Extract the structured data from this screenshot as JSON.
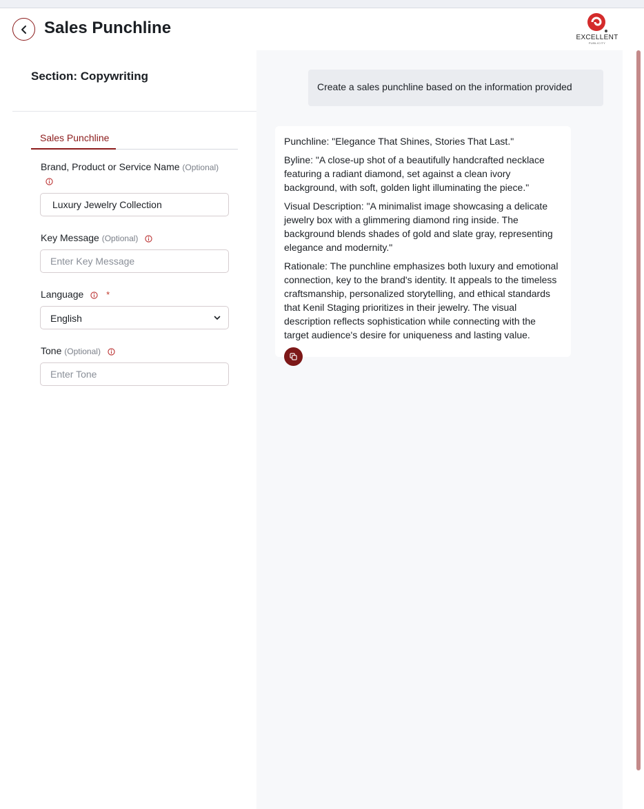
{
  "header": {
    "title": "Sales Punchline",
    "logo_text": "EXCELLENT",
    "logo_subtext": "PUBLICITY"
  },
  "left": {
    "section_title": "Section: Copywriting",
    "tab_active": "Sales Punchline",
    "fields": {
      "brand": {
        "label": "Brand, Product or Service Name",
        "optional": "(Optional)",
        "value": "Luxury Jewelry Collection"
      },
      "key_message": {
        "label": "Key Message",
        "optional": "(Optional)",
        "placeholder": "Enter Key Message"
      },
      "language": {
        "label": "Language",
        "required_mark": "*",
        "value": "English"
      },
      "tone": {
        "label": "Tone",
        "optional": "(Optional)",
        "placeholder": "Enter Tone"
      }
    }
  },
  "right": {
    "prompt": "Create a sales punchline based on the information provided",
    "response": [
      "Punchline: \"Elegance That Shines, Stories That Last.\"",
      "Byline: \"A close-up shot of a beautifully handcrafted necklace featuring a radiant diamond, set against a clean ivory background, with soft, golden light illuminating the piece.\"",
      "Visual Description: \"A minimalist image showcasing a delicate jewelry box with a glimmering diamond ring inside. The background blends shades of gold and slate gray, representing elegance and modernity.\"",
      "Rationale: The punchline emphasizes both luxury and emotional connection, key to the brand's identity. It appeals to the timeless craftsmanship, personalized storytelling, and ethical standards that Kenil Staging prioritizes in their jewelry. The visual description reflects sophistication while connecting with the target audience's desire for uniqueness and lasting value."
    ]
  },
  "colors": {
    "accent": "#8b1a1a",
    "panel_bg": "#f7f8fa",
    "prompt_bg": "#eaecf0"
  },
  "icons": [
    "back-arrow-icon",
    "info-icon",
    "chevron-down-icon",
    "copy-icon",
    "logo-swirl-icon"
  ]
}
